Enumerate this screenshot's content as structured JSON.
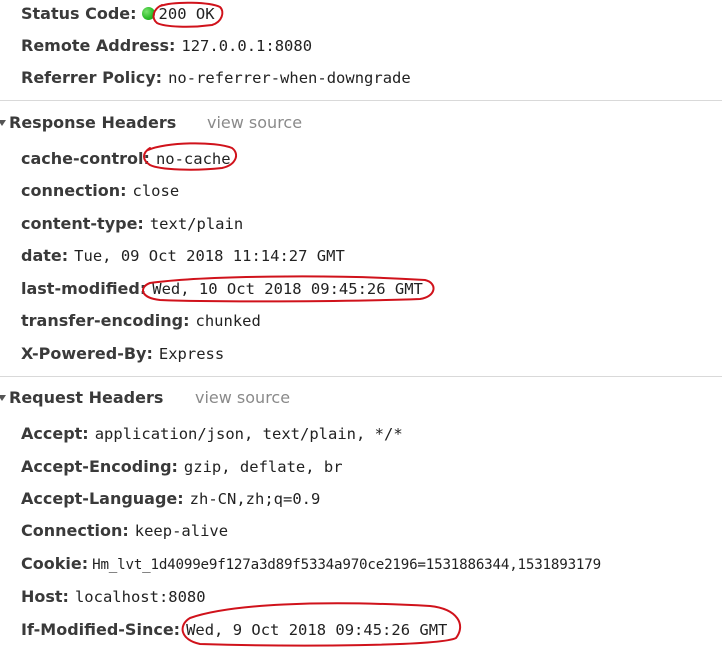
{
  "general": [
    {
      "name": "Status Code:",
      "value": "200 OK"
    },
    {
      "name": "Remote Address:",
      "value": "127.0.0.1:8080"
    },
    {
      "name": "Referrer Policy:",
      "value": "no-referrer-when-downgrade"
    }
  ],
  "response_headers": {
    "title": "Response Headers",
    "view_source": "view source",
    "items": [
      {
        "name": "cache-control:",
        "value": "no-cache"
      },
      {
        "name": "connection:",
        "value": "close"
      },
      {
        "name": "content-type:",
        "value": "text/plain"
      },
      {
        "name": "date:",
        "value": "Tue, 09 Oct 2018 11:14:27 GMT"
      },
      {
        "name": "last-modified:",
        "value": "Wed, 10 Oct 2018 09:45:26 GMT"
      },
      {
        "name": "transfer-encoding:",
        "value": "chunked"
      },
      {
        "name": "X-Powered-By:",
        "value": "Express"
      }
    ]
  },
  "request_headers": {
    "title": "Request Headers",
    "view_source": "view source",
    "items": [
      {
        "name": "Accept:",
        "value": "application/json, text/plain, */*"
      },
      {
        "name": "Accept-Encoding:",
        "value": "gzip, deflate, br"
      },
      {
        "name": "Accept-Language:",
        "value": "zh-CN,zh;q=0.9"
      },
      {
        "name": "Connection:",
        "value": "keep-alive"
      },
      {
        "name": "Cookie:",
        "value": "Hm_lvt_1d4099e9f127a3d89f5334a970ce2196=1531886344,1531893179"
      },
      {
        "name": "Host:",
        "value": "localhost:8080"
      },
      {
        "name": "If-Modified-Since:",
        "value": "Wed, 9 Oct 2018 09:45:26 GMT"
      }
    ]
  },
  "colors": {
    "status_ok": "#2ebd2a",
    "annotation": "#d0121b",
    "muted": "#8a8a8a"
  }
}
